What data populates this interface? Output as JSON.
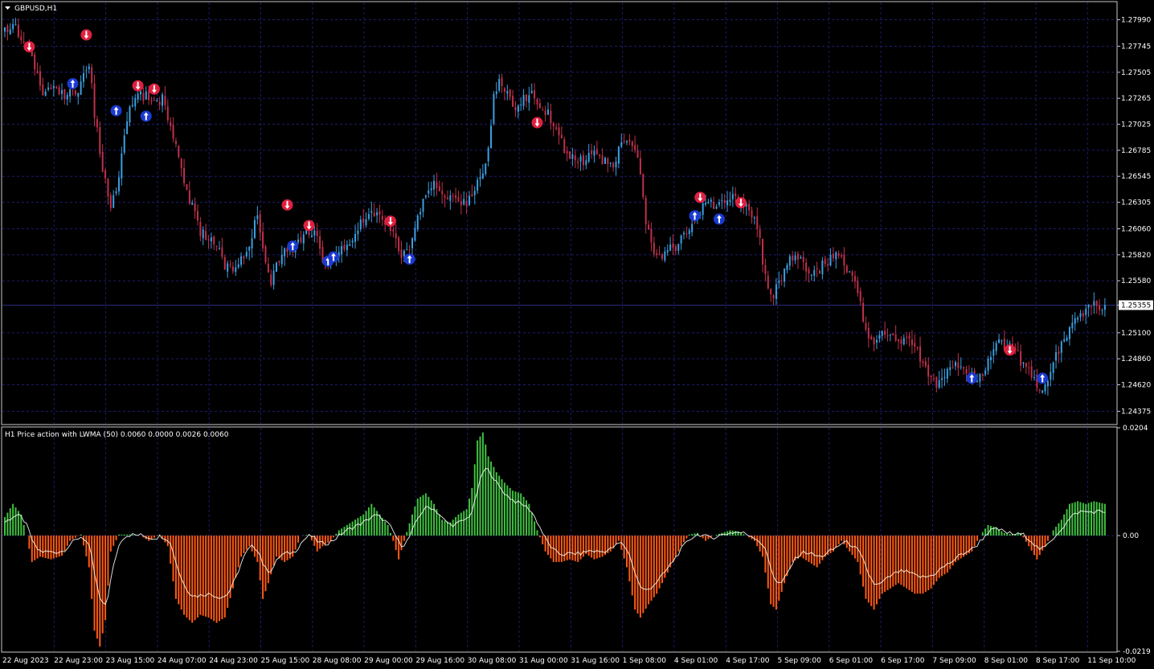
{
  "window": {
    "title": "GBPUSD,H1"
  },
  "indicator": {
    "title": "H1 Price action with LWMA (50) 0.0060 0.0000 0.0026 0.0060"
  },
  "colors": {
    "background": "#000000",
    "grid": "#1c1c6e",
    "bull_candle": "#3aa0e0",
    "bear_candle": "#c0304a",
    "sell_arrow": "#e02040",
    "buy_arrow": "#1a3ad0",
    "hist_positive": "#40c040",
    "hist_negative": "#ff5a14",
    "lwma_line": "#ffffff",
    "current_price_line": "#2b2b80"
  },
  "icons": {
    "sell_signal": "down-arrow-circle-icon",
    "buy_signal": "up-arrow-circle-icon"
  },
  "chart_data": [
    {
      "type": "candlestick",
      "symbol": "GBPUSD",
      "timeframe": "H1",
      "ylim": [
        1.2426,
        1.2815
      ],
      "y_ticks": [
        "1.27990",
        "1.27745",
        "1.27505",
        "1.27265",
        "1.27025",
        "1.26785",
        "1.26545",
        "1.26305",
        "1.26060",
        "1.25820",
        "1.25580",
        "1.25355",
        "1.25100",
        "1.24860",
        "1.24620",
        "1.24375"
      ],
      "current_price": "1.25355",
      "x_labels": [
        "22 Aug 2023",
        "22 Aug 23:00",
        "23 Aug 15:00",
        "24 Aug 07:00",
        "24 Aug 23:00",
        "25 Aug 15:00",
        "28 Aug 08:00",
        "29 Aug 00:00",
        "29 Aug 16:00",
        "30 Aug 08:00",
        "31 Aug 00:00",
        "31 Aug 16:00",
        "1 Sep 08:00",
        "4 Sep 01:00",
        "4 Sep 17:00",
        "5 Sep 09:00",
        "6 Sep 01:00",
        "6 Sep 17:00",
        "7 Sep 09:00",
        "8 Sep 01:00",
        "8 Sep 17:00",
        "11 Sep 10:00"
      ],
      "price_path": [
        [
          0,
          1.279
        ],
        [
          3,
          1.2797
        ],
        [
          6,
          1.278
        ],
        [
          10,
          1.2766
        ],
        [
          14,
          1.2728
        ],
        [
          17,
          1.2734
        ],
        [
          22,
          1.273
        ],
        [
          27,
          1.2735
        ],
        [
          29,
          1.2748
        ],
        [
          31,
          1.276
        ],
        [
          33,
          1.2712
        ],
        [
          36,
          1.2662
        ],
        [
          39,
          1.2625
        ],
        [
          41,
          1.264
        ],
        [
          44,
          1.269
        ],
        [
          46,
          1.272
        ],
        [
          49,
          1.273
        ],
        [
          52,
          1.2728
        ],
        [
          55,
          1.2722
        ],
        [
          58,
          1.2726
        ],
        [
          60,
          1.2705
        ],
        [
          63,
          1.268
        ],
        [
          66,
          1.265
        ],
        [
          69,
          1.2625
        ],
        [
          72,
          1.2603
        ],
        [
          75,
          1.2598
        ],
        [
          78,
          1.259
        ],
        [
          81,
          1.2572
        ],
        [
          84,
          1.2568
        ],
        [
          87,
          1.2576
        ],
        [
          90,
          1.2592
        ],
        [
          93,
          1.2618
        ],
        [
          96,
          1.258
        ],
        [
          98,
          1.2558
        ],
        [
          100,
          1.257
        ],
        [
          103,
          1.259
        ],
        [
          106,
          1.2586
        ],
        [
          109,
          1.2595
        ],
        [
          111,
          1.26
        ],
        [
          114,
          1.2604
        ],
        [
          117,
          1.2578
        ],
        [
          119,
          1.2573
        ],
        [
          122,
          1.258
        ],
        [
          125,
          1.2588
        ],
        [
          128,
          1.2596
        ],
        [
          131,
          1.261
        ],
        [
          134,
          1.2618
        ],
        [
          137,
          1.2624
        ],
        [
          140,
          1.2612
        ],
        [
          143,
          1.26
        ],
        [
          146,
          1.258
        ],
        [
          149,
          1.259
        ],
        [
          152,
          1.2618
        ],
        [
          155,
          1.264
        ],
        [
          158,
          1.2648
        ],
        [
          161,
          1.264
        ],
        [
          164,
          1.2635
        ],
        [
          167,
          1.2628
        ],
        [
          170,
          1.263
        ],
        [
          173,
          1.2645
        ],
        [
          176,
          1.266
        ],
        [
          178,
          1.268
        ],
        [
          180,
          1.2728
        ],
        [
          182,
          1.2742
        ],
        [
          185,
          1.273
        ],
        [
          188,
          1.272
        ],
        [
          191,
          1.2726
        ],
        [
          194,
          1.273
        ],
        [
          197,
          1.2722
        ],
        [
          200,
          1.2712
        ],
        [
          203,
          1.2698
        ],
        [
          206,
          1.268
        ],
        [
          209,
          1.2672
        ],
        [
          212,
          1.2668
        ],
        [
          215,
          1.2672
        ],
        [
          218,
          1.2676
        ],
        [
          221,
          1.2668
        ],
        [
          224,
          1.2664
        ],
        [
          227,
          1.2688
        ],
        [
          230,
          1.2684
        ],
        [
          233,
          1.2672
        ],
        [
          236,
          1.2615
        ],
        [
          238,
          1.259
        ],
        [
          241,
          1.2582
        ],
        [
          244,
          1.2585
        ],
        [
          247,
          1.259
        ],
        [
          250,
          1.2598
        ],
        [
          253,
          1.261
        ],
        [
          256,
          1.2622
        ],
        [
          259,
          1.2632
        ],
        [
          262,
          1.2626
        ],
        [
          265,
          1.263
        ],
        [
          268,
          1.2634
        ],
        [
          271,
          1.2632
        ],
        [
          274,
          1.2626
        ],
        [
          277,
          1.261
        ],
        [
          280,
          1.256
        ],
        [
          283,
          1.2545
        ],
        [
          286,
          1.256
        ],
        [
          289,
          1.2576
        ],
        [
          292,
          1.2578
        ],
        [
          295,
          1.257
        ],
        [
          298,
          1.2565
        ],
        [
          301,
          1.2572
        ],
        [
          304,
          1.2578
        ],
        [
          307,
          1.2582
        ],
        [
          310,
          1.257
        ],
        [
          313,
          1.256
        ],
        [
          316,
          1.2522
        ],
        [
          319,
          1.25
        ],
        [
          322,
          1.2508
        ],
        [
          325,
          1.2507
        ],
        [
          328,
          1.2506
        ],
        [
          331,
          1.2504
        ],
        [
          334,
          1.25
        ],
        [
          337,
          1.2486
        ],
        [
          340,
          1.247
        ],
        [
          343,
          1.2462
        ],
        [
          346,
          1.2468
        ],
        [
          349,
          1.248
        ],
        [
          352,
          1.2474
        ],
        [
          355,
          1.247
        ],
        [
          358,
          1.2468
        ],
        [
          360,
          1.2466
        ],
        [
          363,
          1.249
        ],
        [
          366,
          1.25
        ],
        [
          369,
          1.2496
        ],
        [
          372,
          1.2494
        ],
        [
          375,
          1.248
        ],
        [
          378,
          1.2472
        ],
        [
          381,
          1.2458
        ],
        [
          384,
          1.2468
        ],
        [
          387,
          1.2488
        ],
        [
          390,
          1.2502
        ],
        [
          393,
          1.2518
        ],
        [
          396,
          1.2528
        ],
        [
          399,
          1.2532
        ],
        [
          402,
          1.2536
        ],
        [
          405,
          1.2534
        ]
      ],
      "sell_signals": [
        [
          9,
          1.2774
        ],
        [
          30,
          1.2785
        ],
        [
          49,
          1.2738
        ],
        [
          55,
          1.2735
        ],
        [
          104,
          1.2628
        ],
        [
          112,
          1.2609
        ],
        [
          142,
          1.2613
        ],
        [
          196,
          1.2704
        ],
        [
          256,
          1.2635
        ],
        [
          271,
          1.263
        ],
        [
          370,
          1.2494
        ]
      ],
      "buy_signals": [
        [
          25,
          1.274
        ],
        [
          41,
          1.2715
        ],
        [
          52,
          1.271
        ],
        [
          106,
          1.259
        ],
        [
          119,
          1.2576
        ],
        [
          121,
          1.258
        ],
        [
          149,
          1.2578
        ],
        [
          254,
          1.2618
        ],
        [
          263,
          1.2615
        ],
        [
          356,
          1.2468
        ],
        [
          382,
          1.2468
        ]
      ]
    },
    {
      "type": "histogram",
      "title": "H1 Price action with LWMA (50)",
      "ylim": [
        -0.0219,
        0.0204
      ],
      "y_ticks": [
        "0.0204",
        "0.00",
        "-0.0219"
      ],
      "keypoints": [
        [
          0,
          0.0035
        ],
        [
          3,
          0.006
        ],
        [
          6,
          0.004
        ],
        [
          8,
          0.0
        ],
        [
          10,
          -0.005
        ],
        [
          13,
          -0.004
        ],
        [
          17,
          -0.0045
        ],
        [
          21,
          -0.0038
        ],
        [
          24,
          -0.001
        ],
        [
          28,
          0.0002
        ],
        [
          31,
          -0.006
        ],
        [
          33,
          -0.018
        ],
        [
          35,
          -0.021
        ],
        [
          37,
          -0.016
        ],
        [
          39,
          -0.003
        ],
        [
          42,
          0.0002
        ],
        [
          46,
          0.0002
        ],
        [
          50,
          0.0
        ],
        [
          53,
          -0.001
        ],
        [
          57,
          0.0002
        ],
        [
          60,
          -0.002
        ],
        [
          63,
          -0.012
        ],
        [
          66,
          -0.015
        ],
        [
          69,
          -0.0165
        ],
        [
          72,
          -0.015
        ],
        [
          75,
          -0.0155
        ],
        [
          78,
          -0.0165
        ],
        [
          81,
          -0.0155
        ],
        [
          84,
          -0.01
        ],
        [
          87,
          -0.004
        ],
        [
          90,
          -0.002
        ],
        [
          93,
          -0.005
        ],
        [
          95,
          -0.012
        ],
        [
          97,
          -0.009
        ],
        [
          100,
          -0.004
        ],
        [
          103,
          -0.005
        ],
        [
          106,
          -0.004
        ],
        [
          109,
          0.0
        ],
        [
          112,
          0.0002
        ],
        [
          115,
          -0.003
        ],
        [
          117,
          -0.002
        ],
        [
          120,
          -0.001
        ],
        [
          123,
          0.001
        ],
        [
          126,
          0.002
        ],
        [
          129,
          0.003
        ],
        [
          132,
          0.004
        ],
        [
          135,
          0.006
        ],
        [
          138,
          0.004
        ],
        [
          141,
          0.002
        ],
        [
          143,
          -0.001
        ],
        [
          145,
          -0.0045
        ],
        [
          147,
          -0.001
        ],
        [
          150,
          0.004
        ],
        [
          152,
          0.007
        ],
        [
          155,
          0.008
        ],
        [
          158,
          0.006
        ],
        [
          161,
          0.003
        ],
        [
          164,
          0.0025
        ],
        [
          167,
          0.004
        ],
        [
          170,
          0.005
        ],
        [
          172,
          0.009
        ],
        [
          174,
          0.018
        ],
        [
          176,
          0.0195
        ],
        [
          178,
          0.015
        ],
        [
          181,
          0.012
        ],
        [
          184,
          0.01
        ],
        [
          187,
          0.0085
        ],
        [
          190,
          0.008
        ],
        [
          193,
          0.006
        ],
        [
          196,
          0.001
        ],
        [
          199,
          -0.003
        ],
        [
          202,
          -0.005
        ],
        [
          205,
          -0.005
        ],
        [
          208,
          -0.0045
        ],
        [
          211,
          -0.005
        ],
        [
          214,
          -0.0035
        ],
        [
          217,
          -0.0045
        ],
        [
          220,
          -0.004
        ],
        [
          223,
          -0.003
        ],
        [
          226,
          -0.001
        ],
        [
          229,
          -0.006
        ],
        [
          232,
          -0.014
        ],
        [
          234,
          -0.0155
        ],
        [
          237,
          -0.013
        ],
        [
          240,
          -0.011
        ],
        [
          243,
          -0.008
        ],
        [
          246,
          -0.005
        ],
        [
          249,
          -0.002
        ],
        [
          252,
          0.0002
        ],
        [
          255,
          0.0005
        ],
        [
          258,
          -0.001
        ],
        [
          261,
          0.0
        ],
        [
          264,
          0.0005
        ],
        [
          267,
          0.001
        ],
        [
          270,
          0.0008
        ],
        [
          273,
          0.0
        ],
        [
          276,
          -0.001
        ],
        [
          279,
          -0.004
        ],
        [
          282,
          -0.013
        ],
        [
          284,
          -0.014
        ],
        [
          287,
          -0.009
        ],
        [
          290,
          -0.005
        ],
        [
          293,
          -0.004
        ],
        [
          296,
          -0.005
        ],
        [
          299,
          -0.006
        ],
        [
          302,
          -0.004
        ],
        [
          305,
          -0.003
        ],
        [
          308,
          -0.001
        ],
        [
          311,
          -0.003
        ],
        [
          314,
          -0.005
        ],
        [
          317,
          -0.012
        ],
        [
          320,
          -0.014
        ],
        [
          323,
          -0.011
        ],
        [
          326,
          -0.01
        ],
        [
          329,
          -0.009
        ],
        [
          332,
          -0.01
        ],
        [
          335,
          -0.011
        ],
        [
          338,
          -0.011
        ],
        [
          341,
          -0.01
        ],
        [
          344,
          -0.008
        ],
        [
          347,
          -0.007
        ],
        [
          350,
          -0.005
        ],
        [
          353,
          -0.004
        ],
        [
          356,
          -0.003
        ],
        [
          359,
          0.0
        ],
        [
          362,
          0.002
        ],
        [
          365,
          0.0015
        ],
        [
          368,
          0.0005
        ],
        [
          371,
          0.0002
        ],
        [
          374,
          0.0005
        ],
        [
          377,
          -0.002
        ],
        [
          380,
          -0.0045
        ],
        [
          383,
          -0.002
        ],
        [
          386,
          0.001
        ],
        [
          389,
          0.003
        ],
        [
          392,
          0.006
        ],
        [
          395,
          0.0065
        ],
        [
          398,
          0.006
        ],
        [
          401,
          0.0065
        ],
        [
          405,
          0.006
        ]
      ]
    }
  ]
}
